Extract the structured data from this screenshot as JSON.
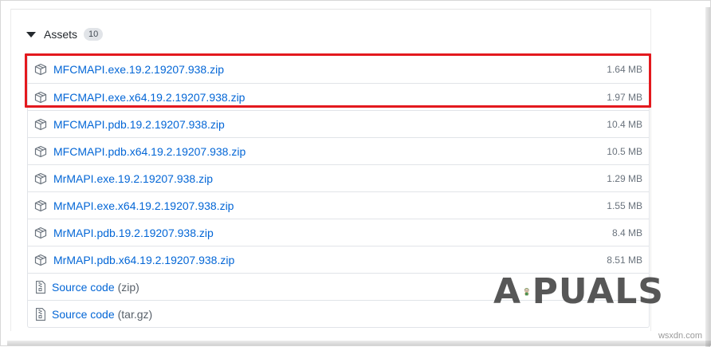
{
  "assets": {
    "label": "Assets",
    "count": "10"
  },
  "files": [
    {
      "name": "MFCMAPI.exe.19.2.19207.938.zip",
      "size": "1.64 MB"
    },
    {
      "name": "MFCMAPI.exe.x64.19.2.19207.938.zip",
      "size": "1.97 MB"
    },
    {
      "name": "MFCMAPI.pdb.19.2.19207.938.zip",
      "size": "10.4 MB"
    },
    {
      "name": "MFCMAPI.pdb.x64.19.2.19207.938.zip",
      "size": "10.5 MB"
    },
    {
      "name": "MrMAPI.exe.19.2.19207.938.zip",
      "size": "1.29 MB"
    },
    {
      "name": "MrMAPI.exe.x64.19.2.19207.938.zip",
      "size": "1.55 MB"
    },
    {
      "name": "MrMAPI.pdb.19.2.19207.938.zip",
      "size": "8.4 MB"
    },
    {
      "name": "MrMAPI.pdb.x64.19.2.19207.938.zip",
      "size": "8.51 MB"
    }
  ],
  "source": [
    {
      "label": "Source code",
      "suffix": "(zip)"
    },
    {
      "label": "Source code",
      "suffix": "(tar.gz)"
    }
  ],
  "watermark": {
    "text_left": "A",
    "text_right": "PUALS",
    "corner": "wsxdn.com"
  },
  "colors": {
    "link": "#0366d6",
    "highlight": "#e3191e",
    "muted": "#6a737d"
  },
  "icons": {
    "asset": "package-icon",
    "source": "file-zip-icon",
    "toggle": "caret-down-icon"
  }
}
